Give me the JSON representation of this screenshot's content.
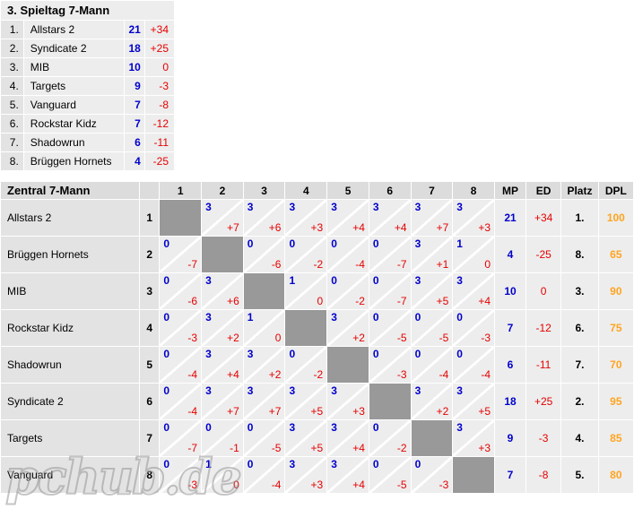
{
  "standings": {
    "title": "3. Spieltag 7-Mann",
    "rows": [
      {
        "rank": "1.",
        "team": "Allstars 2",
        "mp": "21",
        "ed": "+34"
      },
      {
        "rank": "2.",
        "team": "Syndicate 2",
        "mp": "18",
        "ed": "+25"
      },
      {
        "rank": "3.",
        "team": "MIB",
        "mp": "10",
        "ed": "0"
      },
      {
        "rank": "4.",
        "team": "Targets",
        "mp": "9",
        "ed": "-3"
      },
      {
        "rank": "5.",
        "team": "Vanguard",
        "mp": "7",
        "ed": "-8"
      },
      {
        "rank": "6.",
        "team": "Rockstar Kidz",
        "mp": "7",
        "ed": "-12"
      },
      {
        "rank": "7.",
        "team": "Shadowrun",
        "mp": "6",
        "ed": "-11"
      },
      {
        "rank": "8.",
        "team": "Brüggen Hornets",
        "mp": "4",
        "ed": "-25"
      }
    ]
  },
  "crosstable": {
    "title": "Zentral 7-Mann",
    "opponent_headers": [
      "1",
      "2",
      "3",
      "4",
      "5",
      "6",
      "7",
      "8"
    ],
    "stat_headers": [
      "MP",
      "ED",
      "Platz",
      "DPL"
    ],
    "rows": [
      {
        "name": "Allstars 2",
        "num": "1",
        "cells": [
          {
            "self": true
          },
          {
            "top": "3",
            "bottom": "+7"
          },
          {
            "top": "3",
            "bottom": "+6"
          },
          {
            "top": "3",
            "bottom": "+3"
          },
          {
            "top": "3",
            "bottom": "+4"
          },
          {
            "top": "3",
            "bottom": "+4"
          },
          {
            "top": "3",
            "bottom": "+7"
          },
          {
            "top": "3",
            "bottom": "+3"
          }
        ],
        "mp": "21",
        "ed": "+34",
        "platz": "1.",
        "dpl": "100"
      },
      {
        "name": "Brüggen Hornets",
        "num": "2",
        "cells": [
          {
            "top": "0",
            "bottom": "-7"
          },
          {
            "self": true
          },
          {
            "top": "0",
            "bottom": "-6"
          },
          {
            "top": "0",
            "bottom": "-2"
          },
          {
            "top": "0",
            "bottom": "-4"
          },
          {
            "top": "0",
            "bottom": "-7"
          },
          {
            "top": "3",
            "bottom": "+1"
          },
          {
            "top": "1",
            "bottom": "0"
          }
        ],
        "mp": "4",
        "ed": "-25",
        "platz": "8.",
        "dpl": "65"
      },
      {
        "name": "MIB",
        "num": "3",
        "cells": [
          {
            "top": "0",
            "bottom": "-6"
          },
          {
            "top": "3",
            "bottom": "+6"
          },
          {
            "self": true
          },
          {
            "top": "1",
            "bottom": "0"
          },
          {
            "top": "0",
            "bottom": "-2"
          },
          {
            "top": "0",
            "bottom": "-7"
          },
          {
            "top": "3",
            "bottom": "+5"
          },
          {
            "top": "3",
            "bottom": "+4"
          }
        ],
        "mp": "10",
        "ed": "0",
        "platz": "3.",
        "dpl": "90"
      },
      {
        "name": "Rockstar Kidz",
        "num": "4",
        "cells": [
          {
            "top": "0",
            "bottom": "-3"
          },
          {
            "top": "3",
            "bottom": "+2"
          },
          {
            "top": "1",
            "bottom": "0"
          },
          {
            "self": true
          },
          {
            "top": "3",
            "bottom": "+2"
          },
          {
            "top": "0",
            "bottom": "-5"
          },
          {
            "top": "0",
            "bottom": "-5"
          },
          {
            "top": "0",
            "bottom": "-3"
          }
        ],
        "mp": "7",
        "ed": "-12",
        "platz": "6.",
        "dpl": "75"
      },
      {
        "name": "Shadowrun",
        "num": "5",
        "cells": [
          {
            "top": "0",
            "bottom": "-4"
          },
          {
            "top": "3",
            "bottom": "+4"
          },
          {
            "top": "3",
            "bottom": "+2"
          },
          {
            "top": "0",
            "bottom": "-2"
          },
          {
            "self": true
          },
          {
            "top": "0",
            "bottom": "-3"
          },
          {
            "top": "0",
            "bottom": "-4"
          },
          {
            "top": "0",
            "bottom": "-4"
          }
        ],
        "mp": "6",
        "ed": "-11",
        "platz": "7.",
        "dpl": "70"
      },
      {
        "name": "Syndicate 2",
        "num": "6",
        "cells": [
          {
            "top": "0",
            "bottom": "-4"
          },
          {
            "top": "3",
            "bottom": "+7"
          },
          {
            "top": "3",
            "bottom": "+7"
          },
          {
            "top": "3",
            "bottom": "+5"
          },
          {
            "top": "3",
            "bottom": "+3"
          },
          {
            "self": true
          },
          {
            "top": "3",
            "bottom": "+2"
          },
          {
            "top": "3",
            "bottom": "+5"
          }
        ],
        "mp": "18",
        "ed": "+25",
        "platz": "2.",
        "dpl": "95"
      },
      {
        "name": "Targets",
        "num": "7",
        "cells": [
          {
            "top": "0",
            "bottom": "-7"
          },
          {
            "top": "0",
            "bottom": "-1"
          },
          {
            "top": "0",
            "bottom": "-5"
          },
          {
            "top": "3",
            "bottom": "+5"
          },
          {
            "top": "3",
            "bottom": "+4"
          },
          {
            "top": "0",
            "bottom": "-2"
          },
          {
            "self": true
          },
          {
            "top": "3",
            "bottom": "+3"
          }
        ],
        "mp": "9",
        "ed": "-3",
        "platz": "4.",
        "dpl": "85"
      },
      {
        "name": "Vanguard",
        "num": "8",
        "cells": [
          {
            "top": "0",
            "bottom": "-3"
          },
          {
            "top": "1",
            "bottom": "0"
          },
          {
            "top": "0",
            "bottom": "-4"
          },
          {
            "top": "3",
            "bottom": "+3"
          },
          {
            "top": "3",
            "bottom": "+4"
          },
          {
            "top": "0",
            "bottom": "-5"
          },
          {
            "top": "0",
            "bottom": "-3"
          },
          {
            "self": true
          }
        ],
        "mp": "7",
        "ed": "-8",
        "platz": "5.",
        "dpl": "80"
      }
    ]
  },
  "watermark": {
    "text": "pchub.de"
  },
  "colors": {
    "points_blue": "#0000cc",
    "diff_red": "#e60000",
    "dpl_orange": "#ffa420",
    "cell_bg": "#ededed",
    "header_bg": "#dcdcdc",
    "self_cell": "#999999"
  }
}
